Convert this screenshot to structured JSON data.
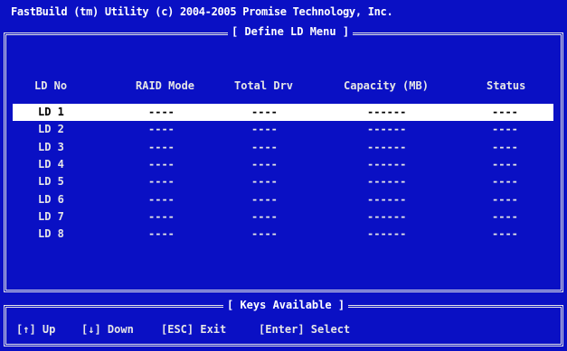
{
  "title": "FastBuild (tm) Utility (c) 2004-2005 Promise Technology, Inc.",
  "menu_caption": "[ Define LD Menu ]",
  "columns": {
    "ld_no": "LD No",
    "raid_mode": "RAID Mode",
    "total_drv": "Total Drv",
    "capacity": "Capacity (MB)",
    "status": "Status"
  },
  "rows": [
    {
      "ld": "LD 1",
      "raid": "----",
      "total": "----",
      "capacity": "------",
      "status": "----",
      "selected": true
    },
    {
      "ld": "LD 2",
      "raid": "----",
      "total": "----",
      "capacity": "------",
      "status": "----",
      "selected": false
    },
    {
      "ld": "LD 3",
      "raid": "----",
      "total": "----",
      "capacity": "------",
      "status": "----",
      "selected": false
    },
    {
      "ld": "LD 4",
      "raid": "----",
      "total": "----",
      "capacity": "------",
      "status": "----",
      "selected": false
    },
    {
      "ld": "LD 5",
      "raid": "----",
      "total": "----",
      "capacity": "------",
      "status": "----",
      "selected": false
    },
    {
      "ld": "LD 6",
      "raid": "----",
      "total": "----",
      "capacity": "------",
      "status": "----",
      "selected": false
    },
    {
      "ld": "LD 7",
      "raid": "----",
      "total": "----",
      "capacity": "------",
      "status": "----",
      "selected": false
    },
    {
      "ld": "LD 8",
      "raid": "----",
      "total": "----",
      "capacity": "------",
      "status": "----",
      "selected": false
    }
  ],
  "keys_caption": "[ Keys Available ]",
  "keys": {
    "up": "[↑] Up",
    "down": "[↓] Down",
    "exit": "[ESC] Exit",
    "select": "[Enter] Select"
  },
  "colors": {
    "background": "#0a10c4",
    "text": "#e6e6e6",
    "highlight": "#ffffff"
  }
}
